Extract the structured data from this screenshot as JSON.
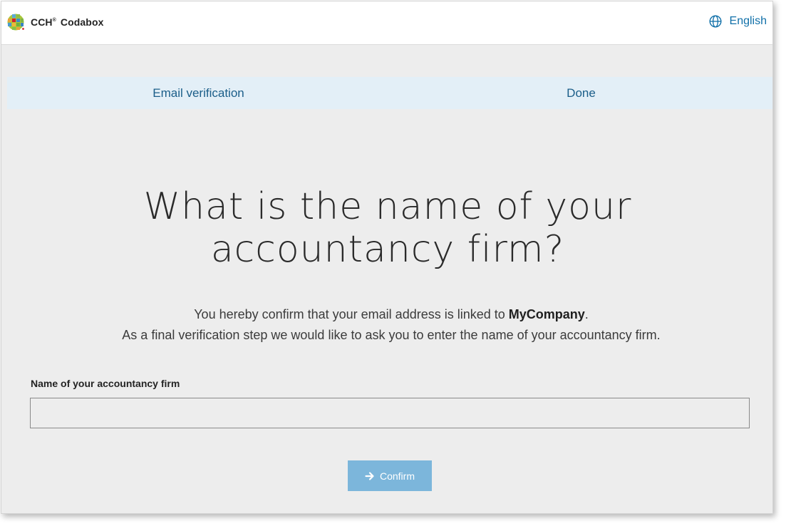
{
  "header": {
    "brand_name": "CCH",
    "brand_superscript": "®",
    "brand_product": "Codabox",
    "language_label": "English",
    "language_icon": "globe-icon"
  },
  "stepper": {
    "steps": [
      {
        "label": "Email verification"
      },
      {
        "label": "Done"
      }
    ]
  },
  "main": {
    "title_line1": "What is the name of your",
    "title_line2": "accountancy firm?",
    "desc_line1_prefix": "You hereby confirm that your email address is linked to ",
    "desc_company": "MyCompany",
    "desc_line1_suffix": ".",
    "desc_line2": "As a final verification step we would like to ask you to enter the name of your accountancy firm.",
    "field_label": "Name of your accountancy firm",
    "field_value": "",
    "confirm_label": "Confirm",
    "confirm_icon": "arrow-right-icon"
  },
  "colors": {
    "accent": "#1170a9",
    "step_bar": "#e3eff7",
    "button_disabled": "#7cb6db",
    "background": "#ededed"
  }
}
